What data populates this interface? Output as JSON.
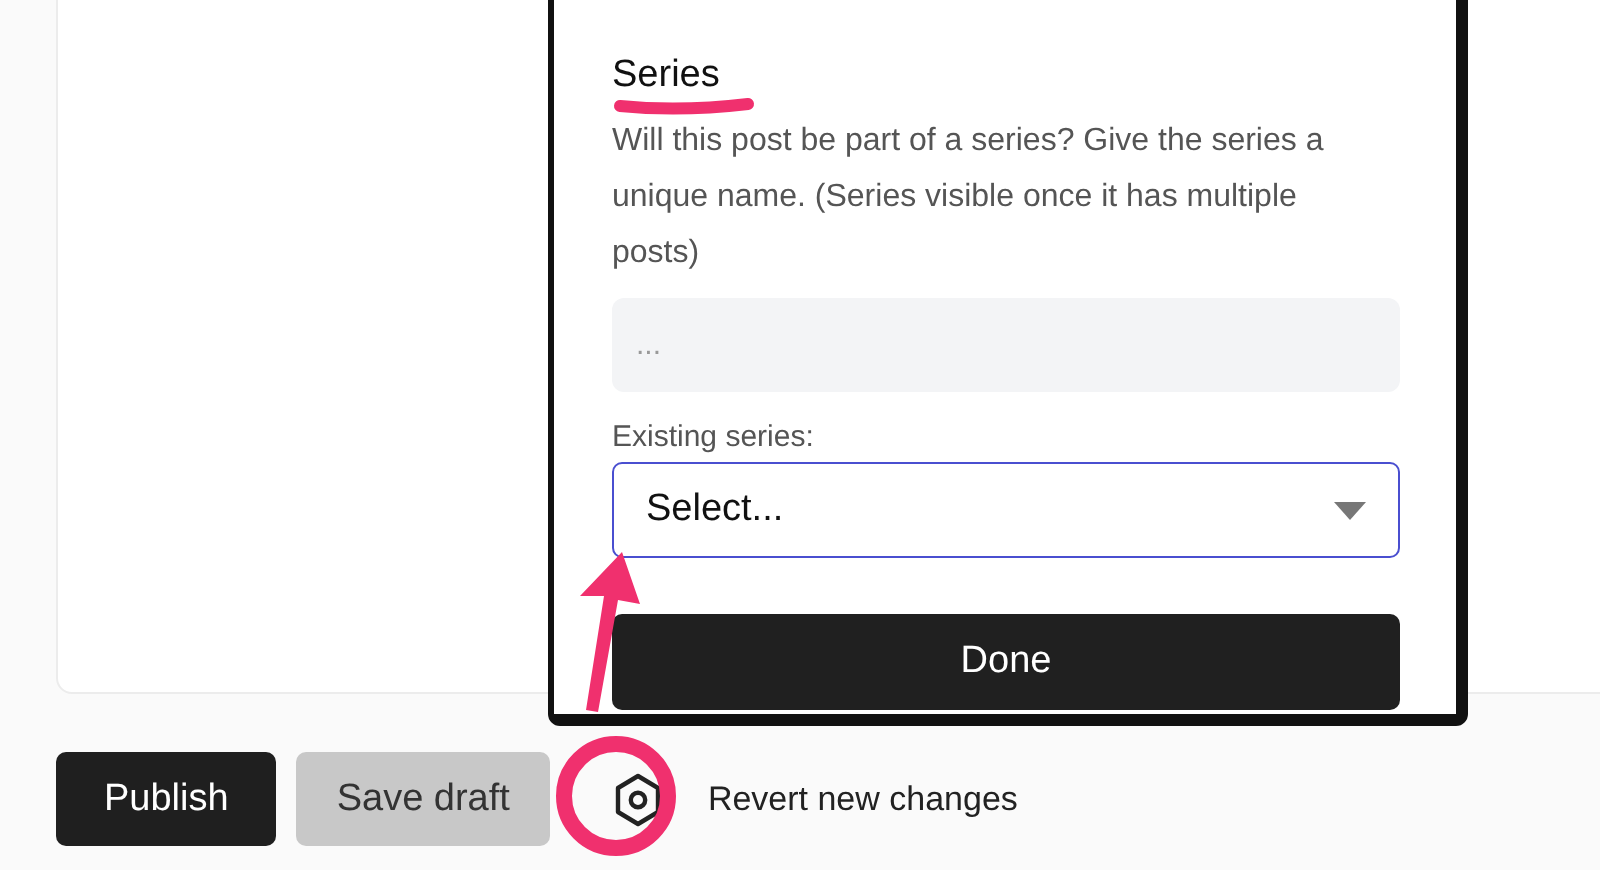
{
  "popover": {
    "heading": "Series",
    "description": "Will this post be part of a series? Give the series a unique name. (Series visible once it has multiple posts)",
    "series_input": {
      "placeholder": "..."
    },
    "existing_label": "Existing series:",
    "select": {
      "value": "Select...",
      "focused": true
    },
    "done_button": "Done"
  },
  "footer": {
    "buttons": [
      {
        "label": "Publish",
        "kind": "primary"
      },
      {
        "label": "Save draft",
        "kind": "secondary"
      }
    ],
    "revert_label": "Revert new changes"
  }
}
